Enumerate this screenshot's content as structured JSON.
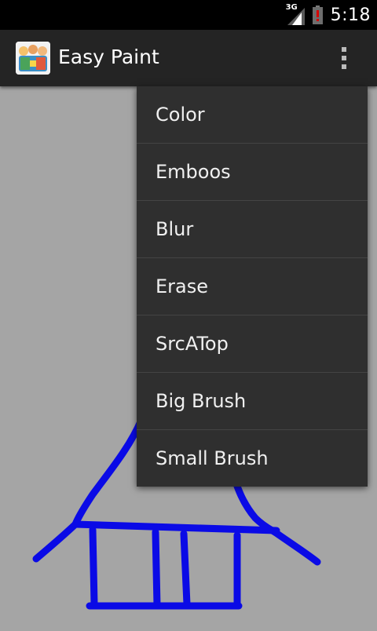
{
  "status_bar": {
    "network_type": "3G",
    "time": "5:18",
    "icons": [
      "signal-icon",
      "battery-alert-icon"
    ]
  },
  "action_bar": {
    "app_title": "Easy Paint",
    "icons": [
      "app-icon",
      "overflow-menu-icon"
    ]
  },
  "menu": {
    "items": [
      {
        "label": "Color"
      },
      {
        "label": "Emboos"
      },
      {
        "label": "Blur"
      },
      {
        "label": "Erase"
      },
      {
        "label": "SrcATop"
      },
      {
        "label": "Big Brush"
      },
      {
        "label": "Small Brush"
      }
    ]
  },
  "canvas": {
    "background_color": "#a5a5a5",
    "stroke_color": "#0a0ae6"
  }
}
